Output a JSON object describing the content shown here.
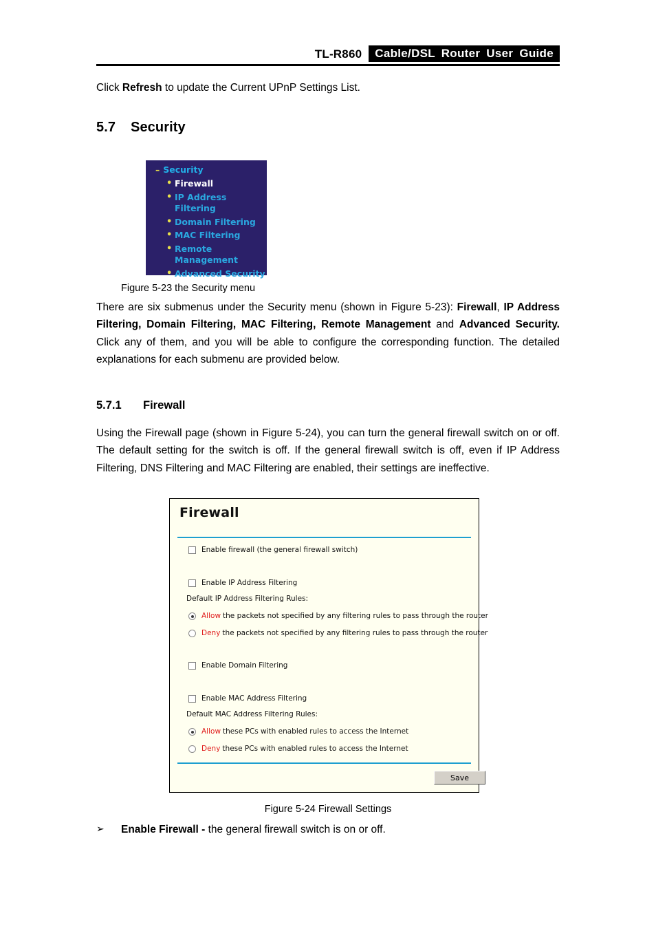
{
  "header": {
    "model": "TL-R860",
    "badge": "Cable/DSL  Router  User  Guide"
  },
  "intro": {
    "before": "Click ",
    "bold": "Refresh",
    "after": " to update the Current UPnP Settings List."
  },
  "section_security": {
    "number": "5.7",
    "title": "Security"
  },
  "security_menu": {
    "root_label": "Security",
    "collapse_icon": "minus-icon",
    "bullet_icon": "bullet-dot-icon",
    "items": [
      {
        "label": "Firewall",
        "active": true
      },
      {
        "label": "IP Address Filtering",
        "active": false
      },
      {
        "label": "Domain Filtering",
        "active": false
      },
      {
        "label": "MAC Filtering",
        "active": false
      },
      {
        "label": "Remote\nManagement",
        "active": false
      },
      {
        "label": "Advanced Security",
        "active": false
      }
    ],
    "colors": {
      "background": "#2b2069",
      "link": "#2aa8e0",
      "active": "#ffffff",
      "bullet": "#e8e04a"
    }
  },
  "figure_523": {
    "caption": "Figure 5-23 the Security menu"
  },
  "paragraph_submenus": {
    "t1": "There are six submenus under the Security menu (shown in Figure 5-23): ",
    "b1": "Firewall",
    "t2": ", ",
    "b2": "IP Address Filtering, Domain Filtering, MAC Filtering, Remote Management",
    "t3": " and ",
    "b3": "Advanced Security.",
    "t4": " Click any of them, and you will be able to configure the corresponding function. The detailed explanations for each submenu are provided below."
  },
  "section_firewall": {
    "number": "5.7.1",
    "title": "Firewall"
  },
  "paragraph_firewall": {
    "text": "Using the Firewall page (shown in Figure 5-24), you can turn the general firewall switch on or off. The default setting for the switch is off. If the general firewall switch is off, even if IP Address Filtering, DNS Filtering and MAC Filtering are enabled, their settings are ineffective."
  },
  "firewall_panel": {
    "title": "Firewall",
    "enable_firewall": {
      "label": "Enable firewall (the general firewall switch)",
      "checked": false
    },
    "enable_ip_filtering": {
      "label": "Enable IP Address Filtering",
      "checked": false
    },
    "ip_rules_heading": "Default IP Address Filtering Rules:",
    "ip_rules": [
      {
        "keyword": "Allow",
        "text": "the packets not specified by any filtering rules to pass through the router",
        "selected": true
      },
      {
        "keyword": "Deny",
        "text": "the packets not specified by any filtering rules to pass through the router",
        "selected": false
      }
    ],
    "enable_domain_filtering": {
      "label": "Enable Domain Filtering",
      "checked": false
    },
    "enable_mac_filtering": {
      "label": "Enable MAC Address Filtering",
      "checked": false
    },
    "mac_rules_heading": "Default MAC Address Filtering Rules:",
    "mac_rules": [
      {
        "keyword": "Allow",
        "text": "these PCs with enabled rules to access the Internet",
        "selected": true
      },
      {
        "keyword": "Deny",
        "text": "these PCs with enabled rules to access the Internet",
        "selected": false
      }
    ],
    "save_label": "Save",
    "colors": {
      "background": "#fffff0",
      "rule": "#1e9fd0",
      "keyword": "#e01b1b"
    }
  },
  "figure_524": {
    "caption": "Figure 5-24 Firewall Settings"
  },
  "bullet_firewall": {
    "marker": "➢",
    "bold": "Enable Firewall - ",
    "text": "the general firewall switch is on or off."
  }
}
